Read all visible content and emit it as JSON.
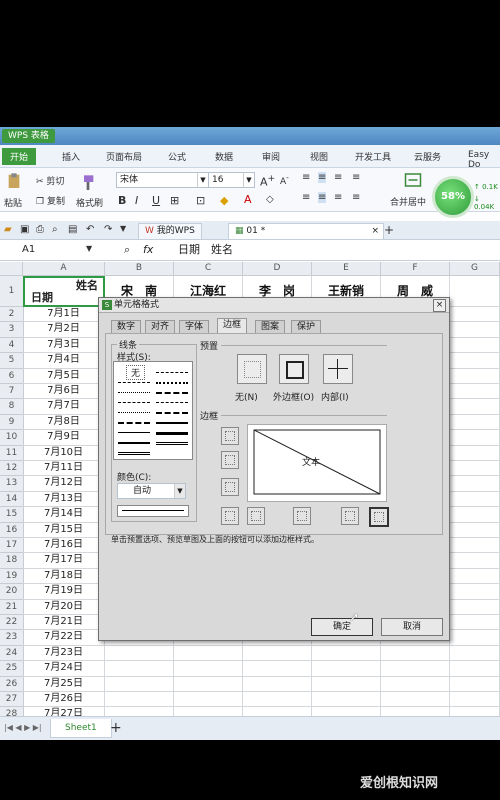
{
  "app": {
    "title": "WPS 表格"
  },
  "menu": [
    "开始",
    "插入",
    "页面布局",
    "公式",
    "数据",
    "审阅",
    "视图",
    "开发工具",
    "云服务",
    "Easy Do"
  ],
  "ribbon": {
    "paste": "粘贴",
    "cut": "剪切",
    "copy": "复制",
    "format_painter": "格式刷",
    "font": "宋体",
    "size": "16",
    "merge_center": "合并居中"
  },
  "badge": {
    "percent": "58%",
    "up": "0.1K",
    "down": "0.04K"
  },
  "doc_tabs": [
    "我的WPS",
    "01 *"
  ],
  "formula_bar": {
    "name_box": "A1",
    "fx": "fx",
    "content": "日期　姓名"
  },
  "columns": [
    "A",
    "B",
    "C",
    "D",
    "E",
    "F",
    "G"
  ],
  "header_row": {
    "a1_top": "姓名",
    "a1_bottom": "日期",
    "names": [
      "宋　南",
      "江海红",
      "李　岗",
      "王新销",
      "周　威"
    ]
  },
  "row_numbers": [
    "1",
    "2",
    "3",
    "4",
    "5",
    "6",
    "7",
    "8",
    "9",
    "10",
    "11",
    "12",
    "13",
    "14",
    "15",
    "16",
    "17",
    "18",
    "19",
    "20",
    "21",
    "22",
    "23",
    "24",
    "25",
    "26",
    "27",
    "28"
  ],
  "dates": [
    "7月1日",
    "7月2日",
    "7月3日",
    "7月4日",
    "7月5日",
    "7月6日",
    "7月7日",
    "7月8日",
    "7月9日",
    "7月10日",
    "7月11日",
    "7月12日",
    "7月13日",
    "7月14日",
    "7月15日",
    "7月16日",
    "7月17日",
    "7月18日",
    "7月19日",
    "7月20日",
    "7月21日",
    "7月22日",
    "7月23日",
    "7月24日",
    "7月25日",
    "7月26日",
    "7月27日"
  ],
  "sheet": {
    "name": "Sheet1",
    "add": "+"
  },
  "dialog": {
    "title": "单元格格式",
    "tabs": [
      "数字",
      "对齐",
      "字体",
      "边框",
      "图案",
      "保护"
    ],
    "line_group": "线条",
    "style_label": "样式(S):",
    "none_label": "无",
    "color_label": "颜色(C):",
    "color_value": "自动",
    "preset_group": "预置",
    "presets": [
      "无(N)",
      "外边框(O)",
      "内部(I)"
    ],
    "border_group": "边框",
    "preview_text": "文本",
    "hint": "单击预置选项、预览草图及上面的按钮可以添加边框样式。",
    "ok": "确定",
    "cancel": "取消"
  },
  "watermark": "爱创根知识网"
}
